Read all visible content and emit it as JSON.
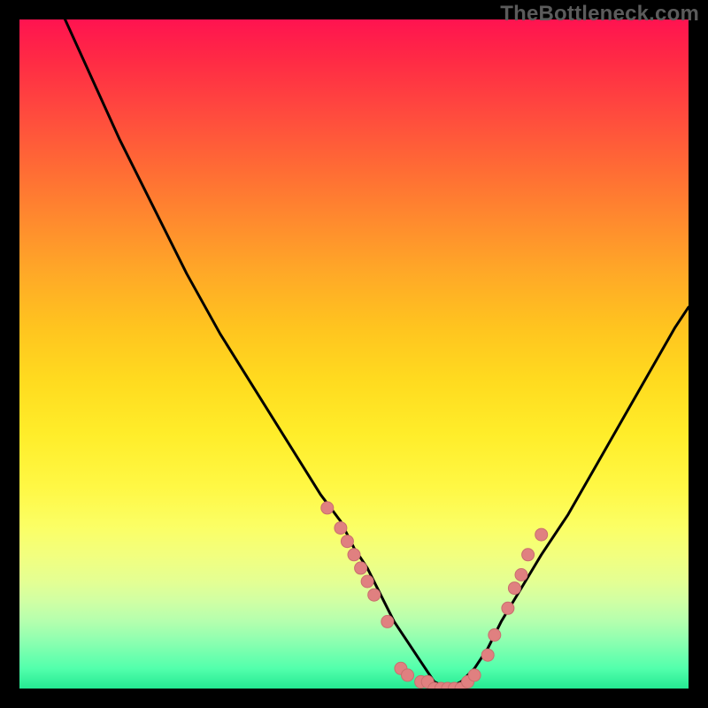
{
  "watermark": "TheBottleneck.com",
  "colors": {
    "axis_frame": "#000000",
    "curve": "#000000",
    "marker": "#de7f7f",
    "gradient_top": "#ff1350",
    "gradient_bottom": "#25e992"
  },
  "chart_data": {
    "type": "line",
    "title": "",
    "xlabel": "",
    "ylabel": "",
    "xlim": [
      0,
      100
    ],
    "ylim": [
      0,
      100
    ],
    "grid": false,
    "legend": false,
    "note": "x is horizontal position (≈ relative GPU/CPU capability); y is vertical distance from bottom (≈ bottleneck %). Curve forms a V with minimum near x≈63; y=0 at the flat bottom. Values below are read off pixel positions.",
    "series": [
      {
        "name": "bottleneck_curve",
        "x": [
          0,
          5,
          10,
          15,
          20,
          25,
          30,
          35,
          40,
          45,
          48,
          50,
          52,
          54,
          56,
          58,
          60,
          62,
          64,
          66,
          68,
          70,
          72,
          75,
          78,
          82,
          86,
          90,
          94,
          98,
          100
        ],
        "y": [
          118,
          104,
          93,
          82,
          72,
          62,
          53,
          45,
          37,
          29,
          25,
          21,
          18,
          14,
          10,
          7,
          4,
          1,
          0,
          1,
          3,
          6,
          10,
          15,
          20,
          26,
          33,
          40,
          47,
          54,
          57
        ]
      }
    ],
    "markers": {
      "name": "highlighted_points",
      "note": "Salmon dots cluster along the curve near the minimum on both flanks",
      "points": [
        {
          "x": 46,
          "y": 27
        },
        {
          "x": 48,
          "y": 24
        },
        {
          "x": 49,
          "y": 22
        },
        {
          "x": 50,
          "y": 20
        },
        {
          "x": 51,
          "y": 18
        },
        {
          "x": 52,
          "y": 16
        },
        {
          "x": 53,
          "y": 14
        },
        {
          "x": 55,
          "y": 10
        },
        {
          "x": 57,
          "y": 3
        },
        {
          "x": 58,
          "y": 2
        },
        {
          "x": 60,
          "y": 1
        },
        {
          "x": 61,
          "y": 1
        },
        {
          "x": 62,
          "y": 0
        },
        {
          "x": 63,
          "y": 0
        },
        {
          "x": 64,
          "y": 0
        },
        {
          "x": 65,
          "y": 0
        },
        {
          "x": 66,
          "y": 0
        },
        {
          "x": 67,
          "y": 1
        },
        {
          "x": 68,
          "y": 2
        },
        {
          "x": 70,
          "y": 5
        },
        {
          "x": 71,
          "y": 8
        },
        {
          "x": 73,
          "y": 12
        },
        {
          "x": 74,
          "y": 15
        },
        {
          "x": 75,
          "y": 17
        },
        {
          "x": 76,
          "y": 20
        },
        {
          "x": 78,
          "y": 23
        }
      ]
    }
  }
}
